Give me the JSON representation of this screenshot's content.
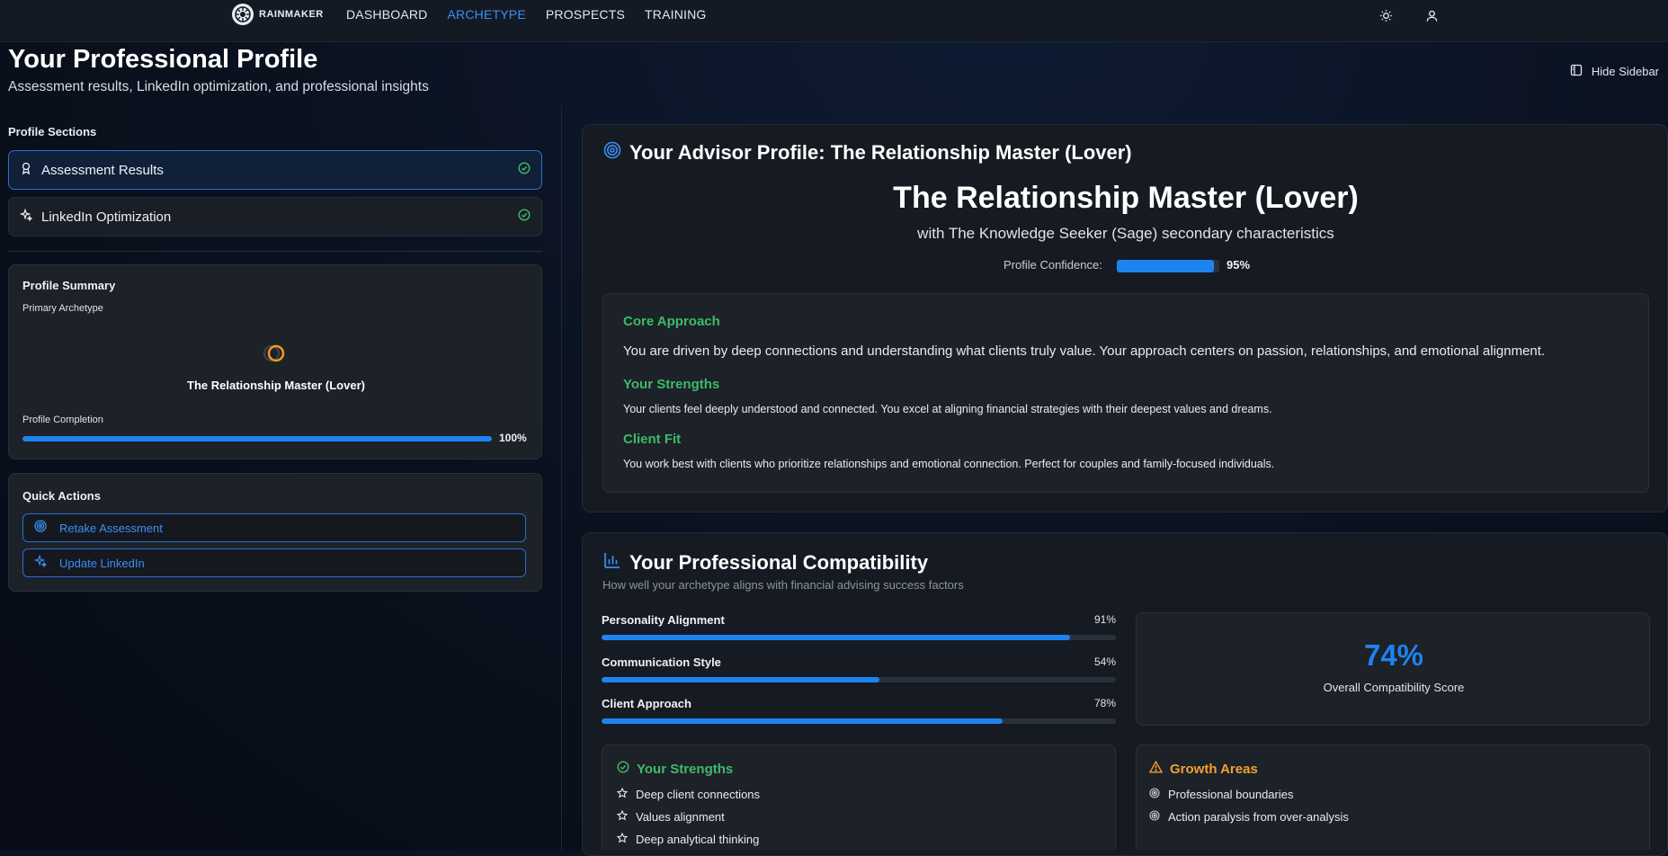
{
  "app": {
    "logo_text": "RAINMAKER"
  },
  "nav": {
    "items": [
      {
        "label": "DASHBOARD",
        "active": false
      },
      {
        "label": "ARCHETYPE",
        "active": true
      },
      {
        "label": "PROSPECTS",
        "active": false
      },
      {
        "label": "TRAINING",
        "active": false
      }
    ]
  },
  "header": {
    "title": "Your Professional Profile",
    "subtitle": "Assessment results, LinkedIn optimization, and professional insights",
    "hide_sidebar_label": "Hide Sidebar"
  },
  "sidebar": {
    "sections_label": "Profile Sections",
    "sections": [
      {
        "label": "Assessment Results",
        "active": true,
        "icon": "award-icon",
        "status_icon": "check-circle-icon"
      },
      {
        "label": "LinkedIn Optimization",
        "active": false,
        "icon": "sparkles-icon",
        "status_icon": "check-circle-icon"
      }
    ],
    "summary": {
      "title": "Profile Summary",
      "primary_label": "Primary Archetype",
      "archetype": "The Relationship Master (Lover)",
      "completion_label": "Profile Completion",
      "completion_value": 100,
      "completion_text": "100%"
    },
    "quick_actions": {
      "title": "Quick Actions",
      "buttons": [
        {
          "label": "Retake Assessment",
          "icon": "target-icon"
        },
        {
          "label": "Update LinkedIn",
          "icon": "sparkles-icon"
        }
      ]
    }
  },
  "advisor": {
    "heading": "Your Advisor Profile: The Relationship Master (Lover)",
    "archetype_title": "The Relationship Master (Lover)",
    "secondary": "with The Knowledge Seeker (Sage) secondary characteristics",
    "confidence_label": "Profile Confidence:",
    "confidence_value": 95,
    "confidence_text": "95%",
    "core_approach_title": "Core Approach",
    "core_approach_text": "You are driven by deep connections and understanding what clients truly value. Your approach centers on passion, relationships, and emotional alignment.",
    "strengths_title": "Your Strengths",
    "strengths_text": "Your clients feel deeply understood and connected. You excel at aligning financial strategies with their deepest values and dreams.",
    "client_fit_title": "Client Fit",
    "client_fit_text": "You work best with clients who prioritize relationships and emotional connection. Perfect for couples and family-focused individuals."
  },
  "compatibility": {
    "heading": "Your Professional Compatibility",
    "subtitle": "How well your archetype aligns with financial advising success factors",
    "rows": [
      {
        "name": "Personality Alignment",
        "value": 91,
        "text": "91%"
      },
      {
        "name": "Communication Style",
        "value": 54,
        "text": "54%"
      },
      {
        "name": "Client Approach",
        "value": 78,
        "text": "78%"
      }
    ],
    "overall_score": "74%",
    "overall_label": "Overall Compatibility Score",
    "strengths_title": "Your Strengths",
    "strengths": [
      "Deep client connections",
      "Values alignment",
      "Deep analytical thinking"
    ],
    "growth_title": "Growth Areas",
    "growth": [
      "Professional boundaries",
      "Action paralysis from over-analysis"
    ]
  },
  "colors": {
    "accent": "#1e83f0",
    "green": "#3dbb6a",
    "orange": "#f0a030"
  }
}
